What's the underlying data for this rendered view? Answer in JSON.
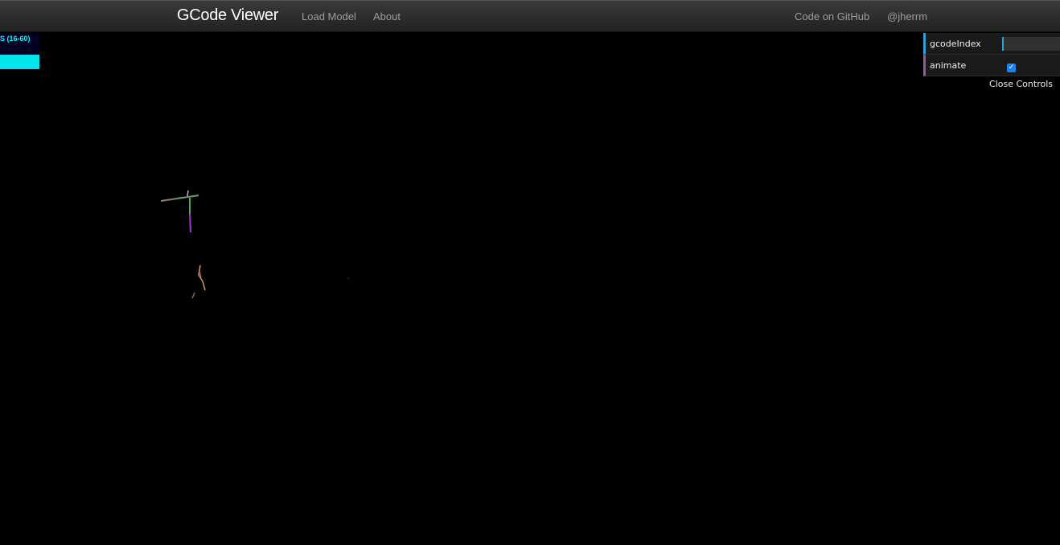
{
  "navbar": {
    "brand": "GCode Viewer",
    "load_model": "Load Model",
    "about": "About",
    "github": "Code on GitHub",
    "user": "@jherrm"
  },
  "stats": {
    "text": "S (16-60)",
    "color": "#00ffff",
    "background": "#000022"
  },
  "controls": {
    "gcode_index_label": "gcodeIndex",
    "gcode_index_fraction": 0.03,
    "animate_label": "animate",
    "animate_checked": true,
    "close_label": "Close Controls",
    "accent_number": "#2fa1d6",
    "accent_boolean": "#806787"
  },
  "viewport": {
    "background": "#000000"
  }
}
